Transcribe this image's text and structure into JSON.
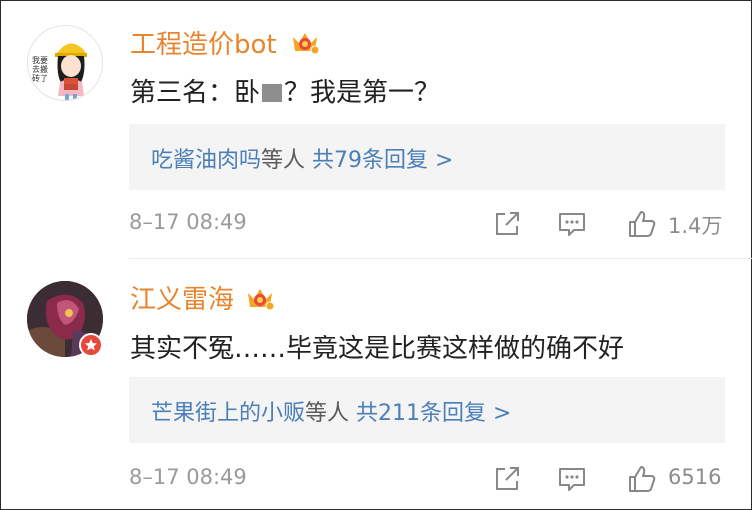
{
  "comments": [
    {
      "username": "工程造价bot",
      "text_before": "第三名：卧",
      "text_after": "？我是第一？",
      "replies_names": "吃酱油肉吗",
      "replies_mid": "等人",
      "replies_count_text": "共79条回复 >",
      "time": "8–17 08:49",
      "likes": "1.4万",
      "avatar_text": "我要去搬砖了"
    },
    {
      "username": "江义雷海",
      "text": "其实不冤……毕竟这是比赛这样做的确不好",
      "replies_names": "芒果街上的小贩",
      "replies_mid": "等人",
      "replies_count_text": "共211条回复 >",
      "time": "8–17 08:49",
      "likes": "6516"
    }
  ],
  "colors": {
    "username": "#e8852e",
    "link": "#4a7fb8",
    "reply_bg": "#f4f4f4",
    "meta": "#9a9a9a",
    "verified_badge": "#e8483a"
  },
  "icons": [
    "share-icon",
    "comment-icon",
    "like-icon",
    "crown-badge-icon",
    "verified-badge-icon"
  ]
}
